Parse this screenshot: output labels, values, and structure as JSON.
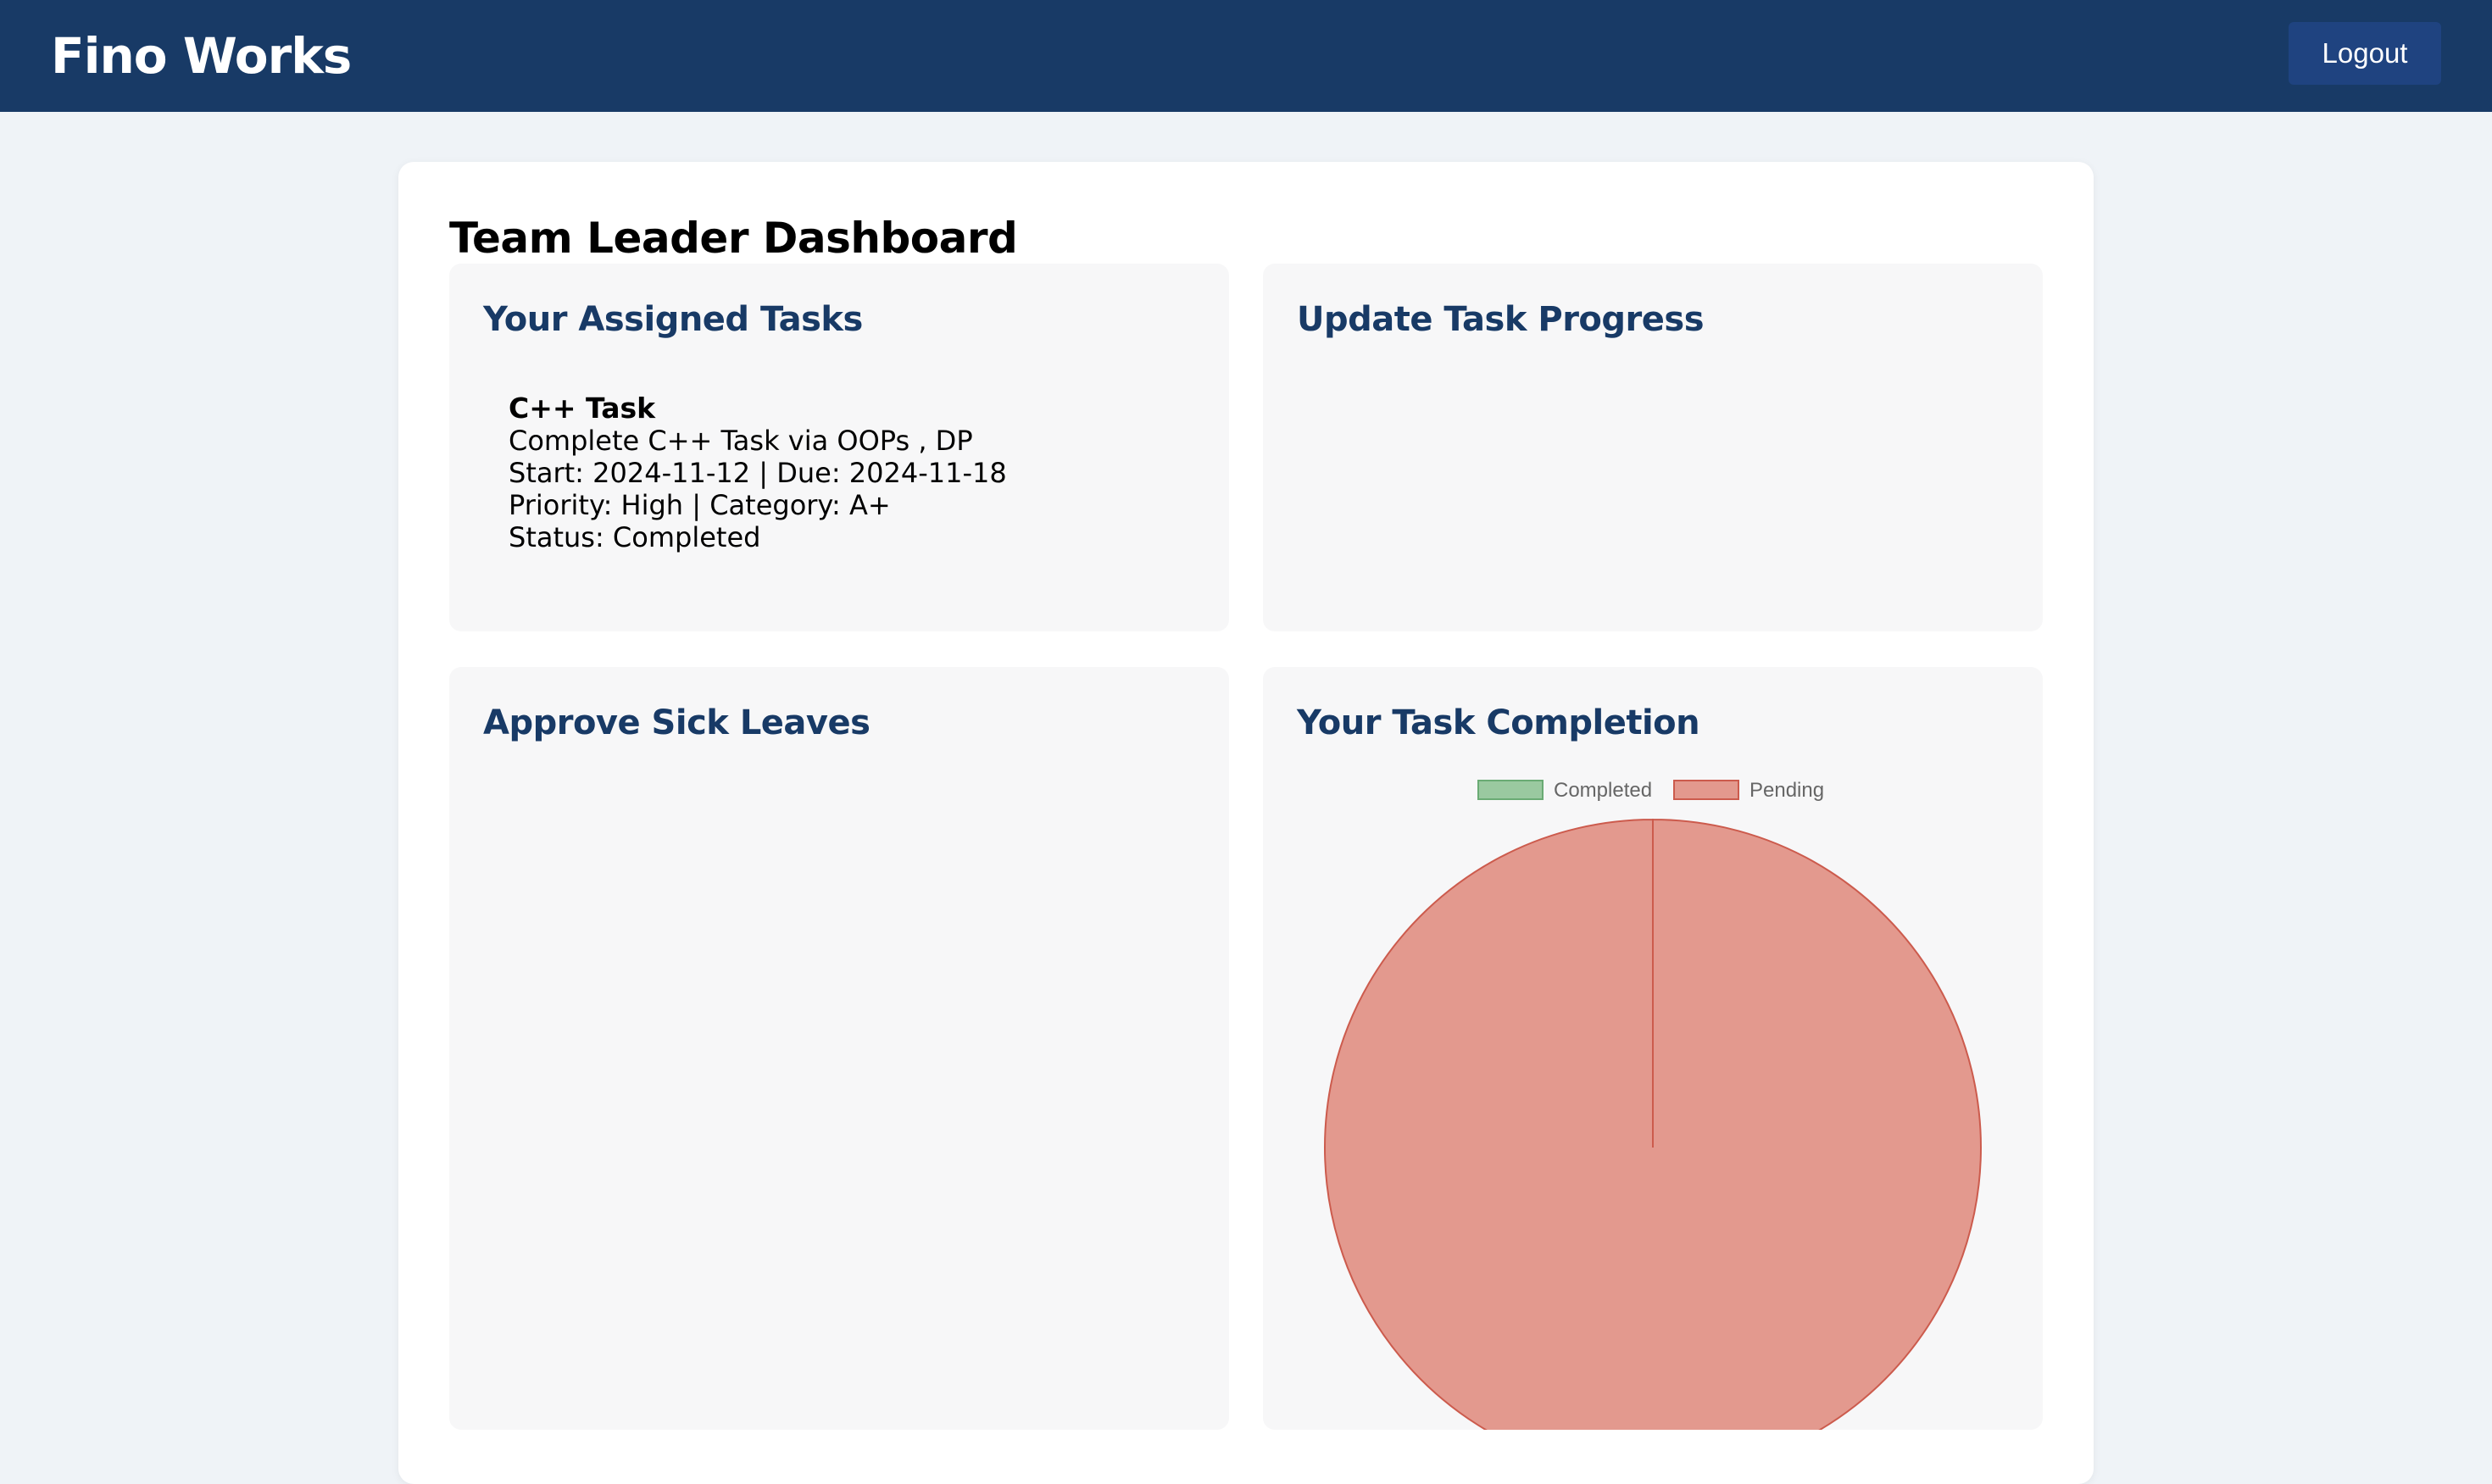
{
  "header": {
    "brand": "Fino Works",
    "logout_label": "Logout"
  },
  "dashboard": {
    "title": "Team Leader Dashboard"
  },
  "panels": {
    "assigned_tasks": {
      "title": "Your Assigned Tasks",
      "tasks": [
        {
          "title": "C++ Task",
          "description": "Complete C++ Task via OOPs , DP",
          "dates": "Start: 2024-11-12 | Due: 2024-11-18",
          "meta": "Priority: High | Category: A+",
          "status": "Status: Completed"
        }
      ]
    },
    "update_progress": {
      "title": "Update Task Progress"
    },
    "sick_leaves": {
      "title": "Approve Sick Leaves"
    },
    "completion": {
      "title": "Your Task Completion"
    }
  },
  "chart_data": {
    "type": "pie",
    "categories": [
      "Completed",
      "Pending"
    ],
    "values": [
      0,
      1
    ],
    "colors": {
      "Completed": {
        "fill": "#9ac9a0",
        "stroke": "#6aab74"
      },
      "Pending": {
        "fill": "#e3998e",
        "stroke": "#cc5b4d"
      }
    },
    "legend": "top"
  }
}
